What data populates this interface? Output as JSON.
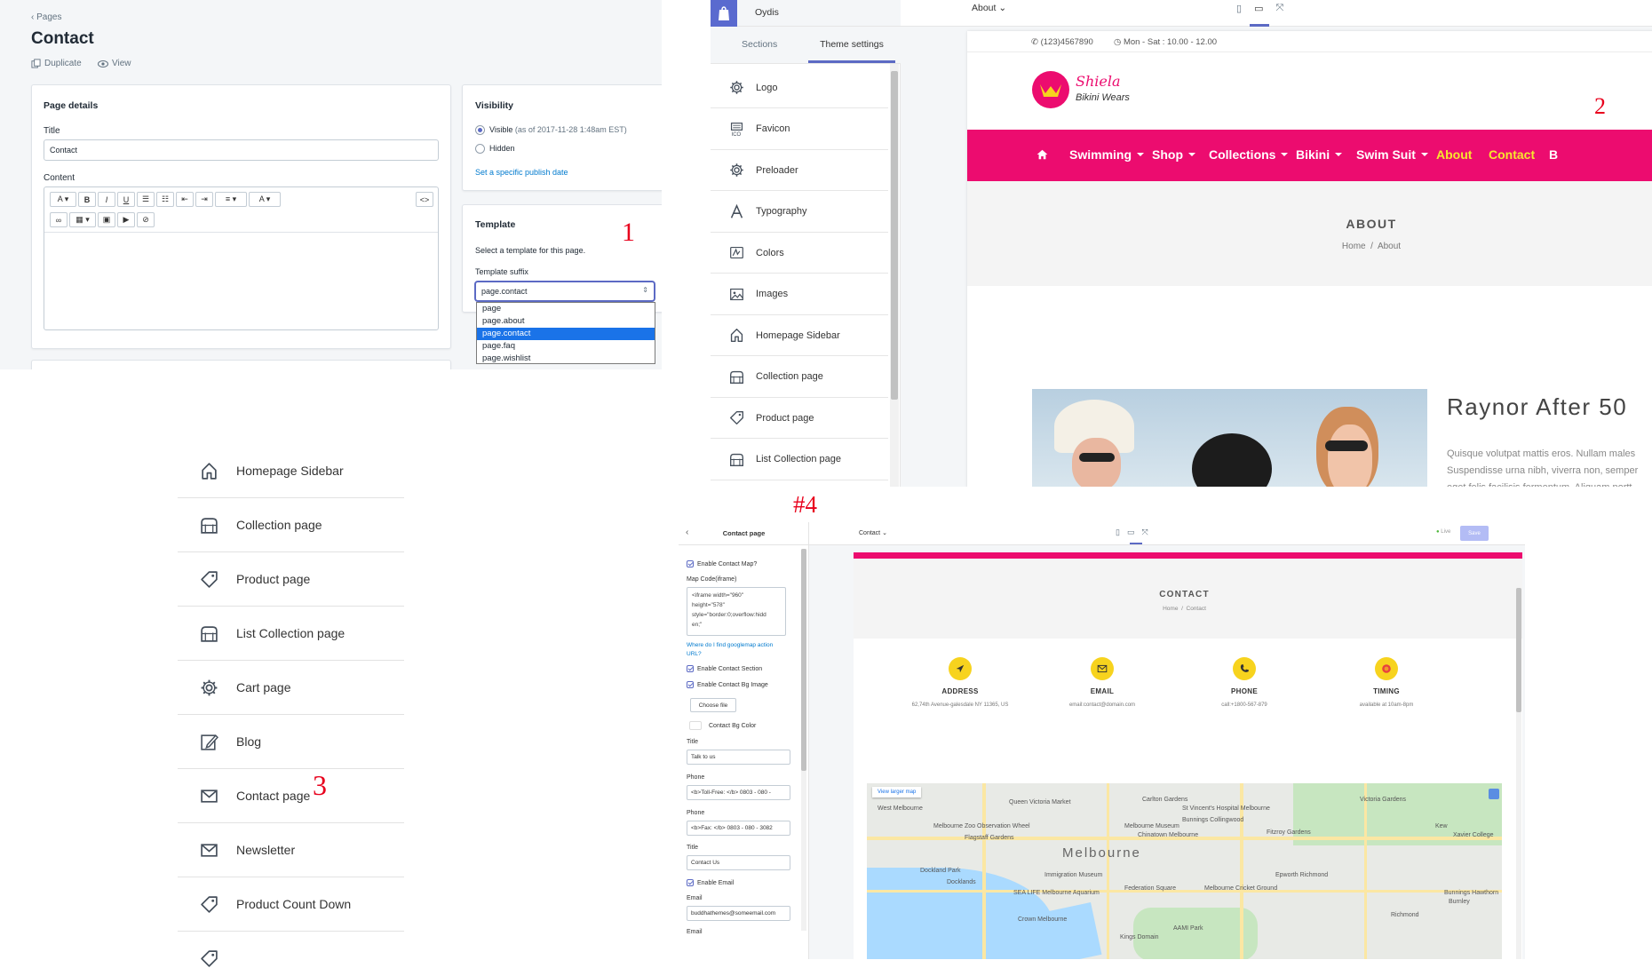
{
  "panel1": {
    "breadcrumb": "Pages",
    "page_title": "Contact",
    "actions": [
      "Duplicate",
      "View"
    ],
    "page_details": {
      "heading": "Page details",
      "title_label": "Title",
      "title_value": "Contact",
      "content_label": "Content"
    },
    "visibility": {
      "heading": "Visibility",
      "visible_label": "Visible",
      "visible_note": "(as of 2017-11-28 1:48am EST)",
      "hidden_label": "Hidden",
      "publish_link": "Set a specific publish date"
    },
    "template": {
      "heading": "Template",
      "description": "Select a template for this page.",
      "suffix_label": "Template suffix",
      "selected": "page.contact",
      "options": [
        "page",
        "page.about",
        "page.contact",
        "page.faq",
        "page.wishlist"
      ]
    },
    "marker": "1"
  },
  "panel2": {
    "store_name": "Oydis",
    "tabs": [
      "Sections",
      "Theme settings"
    ],
    "active_tab": "Theme settings",
    "settings": [
      {
        "label": "Logo",
        "icon": "gear-icon"
      },
      {
        "label": "Favicon",
        "icon": "favicon-icon"
      },
      {
        "label": "Preloader",
        "icon": "gear-icon"
      },
      {
        "label": "Typography",
        "icon": "typography-icon"
      },
      {
        "label": "Colors",
        "icon": "colors-icon"
      },
      {
        "label": "Images",
        "icon": "image-icon"
      },
      {
        "label": "Homepage Sidebar",
        "icon": "home-icon"
      },
      {
        "label": "Collection page",
        "icon": "collection-icon"
      },
      {
        "label": "Product page",
        "icon": "tag-icon"
      },
      {
        "label": "List Collection page",
        "icon": "collection-icon"
      }
    ],
    "page_select": "About",
    "preview": {
      "phone": "(123)4567890",
      "hours": "Mon - Sat : 10.00 - 12.00",
      "logo_name": "Shiela",
      "logo_sub": "Bikini Wears",
      "nav": [
        "Swimming",
        "Shop",
        "Collections",
        "Bikini",
        "Swim Suit",
        "About",
        "Contact",
        "B"
      ],
      "nav_active": [
        "About",
        "Contact"
      ],
      "banner_title": "ABOUT",
      "crumb_home": "Home",
      "crumb_sep": "/",
      "crumb_current": "About",
      "article_title": "Raynor After 50",
      "article_lines": [
        "Quisque volutpat mattis eros. Nullam males",
        "Suspendisse urna nibh, viverra non, semper",
        "eget felis facilisis fermentum. Aliquam portt"
      ]
    },
    "marker": "2",
    "colors": {
      "brand_pink": "#ec0c6f",
      "nav_active": "#f7e72e"
    }
  },
  "panel3": {
    "items": [
      {
        "label": "Homepage Sidebar",
        "icon": "home-icon"
      },
      {
        "label": "Collection page",
        "icon": "collection-icon"
      },
      {
        "label": "Product page",
        "icon": "tag-icon"
      },
      {
        "label": "List Collection page",
        "icon": "collection-icon"
      },
      {
        "label": "Cart page",
        "icon": "gear-icon"
      },
      {
        "label": "Blog",
        "icon": "edit-icon"
      },
      {
        "label": "Contact page",
        "icon": "mail-icon"
      },
      {
        "label": "Newsletter",
        "icon": "mail-icon"
      },
      {
        "label": "Product Count Down",
        "icon": "tag-icon"
      }
    ],
    "marker": "3"
  },
  "panel4": {
    "marker": "#4",
    "sidebar_title": "Contact page",
    "page_select": "Contact",
    "live": "Live",
    "save": "Save",
    "fields": {
      "enable_map": "Enable Contact Map?",
      "map_code_label": "Map Code(iframe)",
      "map_code_lines": [
        "<iframe width=\"960\"",
        "height=\"578\"",
        "style=\"border:0;overflow:hidd",
        "en;\""
      ],
      "map_help": "Where do I find googlemap action URL?",
      "enable_section": "Enable Contact Section",
      "enable_bg": "Enable Contact Bg Image",
      "choose_file": "Choose file",
      "bg_color": "Contact Bg Color",
      "title1_label": "Title",
      "title1_value": "Talk to us",
      "phone1_label": "Phone",
      "phone1_value": "<b>Toll-Free: </b> 0803 - 080 -",
      "phone2_label": "Phone",
      "phone2_value": "<b>Fax: </b> 0803 - 080 - 3082",
      "title2_label": "Title",
      "title2_value": "Contact Us",
      "enable_email": "Enable Email",
      "email_label": "Email",
      "email_value": "buddhathemes@someemail.com",
      "email2_label": "Email"
    },
    "preview": {
      "banner_title": "CONTACT",
      "crumb_home": "Home",
      "crumb_sep": "/",
      "crumb_current": "Contact",
      "info": [
        {
          "title": "ADDRESS",
          "detail": "62,74th Avenue-galesdale NY 11365, US",
          "icon": "location-icon"
        },
        {
          "title": "EMAIL",
          "detail": "email:contact@domain.com",
          "icon": "mail-icon"
        },
        {
          "title": "PHONE",
          "detail": "call:+1800-567-879",
          "icon": "phone-icon"
        },
        {
          "title": "TIMING",
          "detail": "available at 10am-8pm",
          "icon": "clock-icon"
        }
      ],
      "map_link": "View larger map",
      "map_city": "Melbourne",
      "map_labels": [
        "West Melbourne",
        "Queen Victoria Market",
        "Melbourne Zoo Observation Wheel",
        "Flagstaff Gardens",
        "Melbourne Museum",
        "Carlton Gardens",
        "St Vincent's Hospital Melbourne",
        "Bunnings Collingwood",
        "Fitzroy Gardens",
        "Chinatown Melbourne",
        "Dockland Park",
        "Docklands",
        "SEA LIFE Melbourne Aquarium",
        "Immigration Museum",
        "Federation Square",
        "Melbourne Cricket Ground",
        "Crown Melbourne",
        "Epworth Richmond",
        "Victoria Gardens",
        "Kew",
        "Xavier College",
        "Richmond",
        "Burnley",
        "Bunnings Hawthorn",
        "Kings Domain",
        "AAMI Park"
      ]
    }
  }
}
